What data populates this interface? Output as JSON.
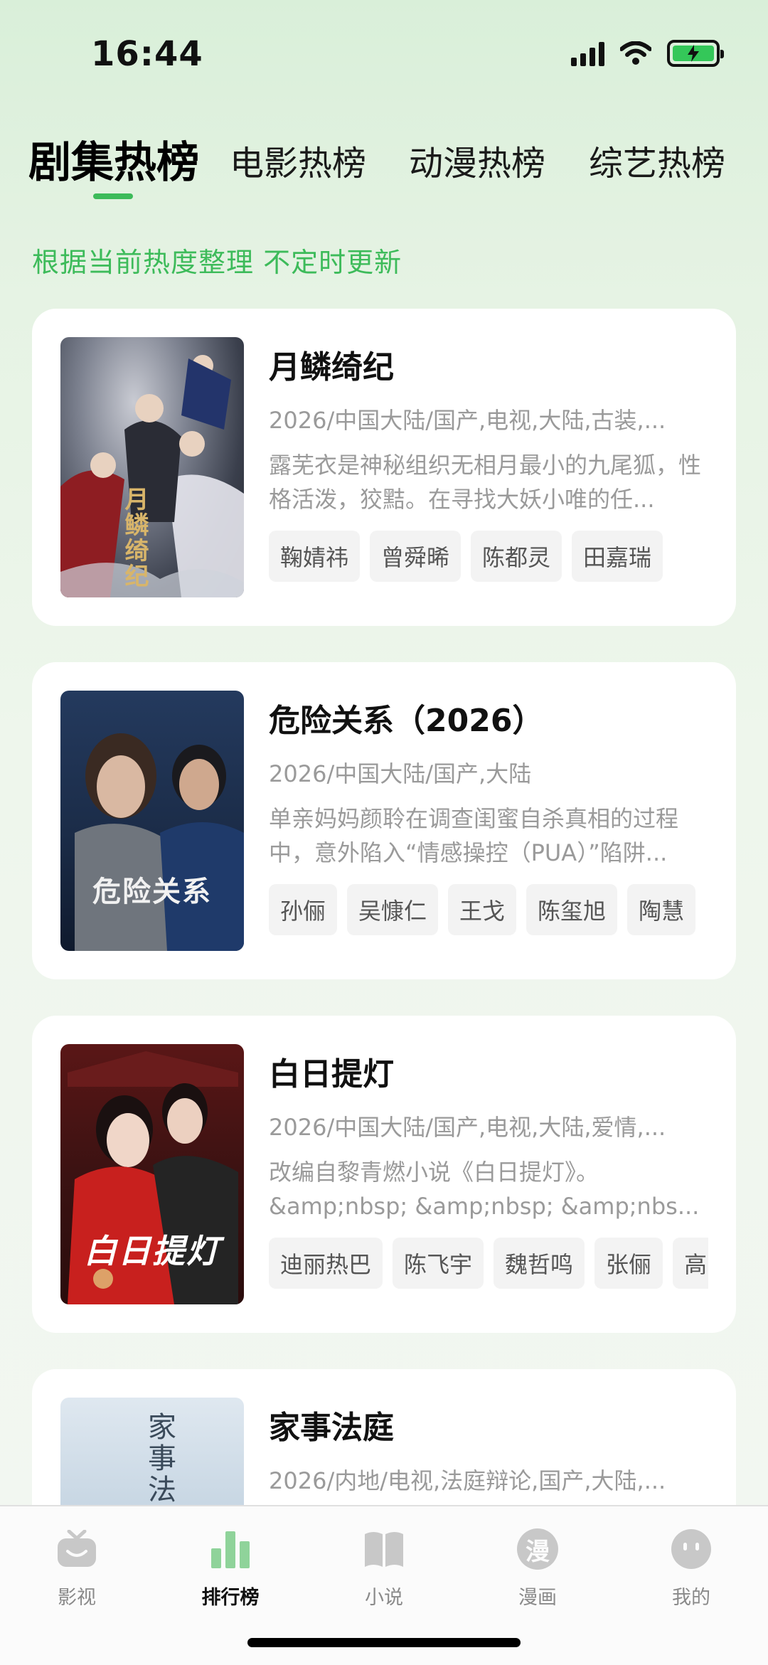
{
  "status": {
    "time": "16:44"
  },
  "tabs": [
    {
      "label": "剧集热榜",
      "active": true
    },
    {
      "label": "电影热榜",
      "active": false
    },
    {
      "label": "动漫热榜",
      "active": false
    },
    {
      "label": "综艺热榜",
      "active": false
    }
  ],
  "subtitle": "根据当前热度整理 不定时更新",
  "cards": [
    {
      "title": "月鳞绮纪",
      "meta": "2026/中国大陆/国产,电视,大陆,古装,...",
      "desc": "露芜衣是神秘组织无相月最小的九尾狐，性格活泼，狡黠。在寻找大妖小唯的任...",
      "poster_text": "月鳞绮纪",
      "cast": [
        "鞠婧祎",
        "曾舜晞",
        "陈都灵",
        "田嘉瑞"
      ]
    },
    {
      "title": "危险关系（2026）",
      "meta": "2026/中国大陆/国产,大陆",
      "desc": "单亲妈妈颜聆在调查闺蜜自杀真相的过程中，意外陷入“情感操控（PUA）”陷阱...",
      "poster_text": "危险关系",
      "cast": [
        "孙俪",
        "吴慷仁",
        "王戈",
        "陈玺旭",
        "陶慧"
      ]
    },
    {
      "title": "白日提灯",
      "meta": "2026/中国大陆/国产,电视,大陆,爱情,...",
      "desc": "改编自黎青燃小说《白日提灯》。&amp;nbsp; &amp;nbsp; &amp;nbs...",
      "poster_text": "白日提灯",
      "cast": [
        "迪丽热巴",
        "陈飞宇",
        "魏哲鸣",
        "张俪",
        "高"
      ]
    },
    {
      "title": "家事法庭",
      "meta": "2026/内地/电视,法庭辩论,国产,大陆,...",
      "desc": "",
      "poster_text": "家事法庭",
      "cast": []
    }
  ],
  "nav": [
    {
      "label": "影视",
      "icon": "tv-icon",
      "active": false
    },
    {
      "label": "排行榜",
      "icon": "bar-chart-icon",
      "active": true
    },
    {
      "label": "小说",
      "icon": "book-icon",
      "active": false
    },
    {
      "label": "漫画",
      "icon": "comic-icon",
      "active": false,
      "glyph": "漫"
    },
    {
      "label": "我的",
      "icon": "profile-icon",
      "active": false
    }
  ],
  "colors": {
    "accent": "#3dbb5a",
    "battery": "#34c759"
  }
}
